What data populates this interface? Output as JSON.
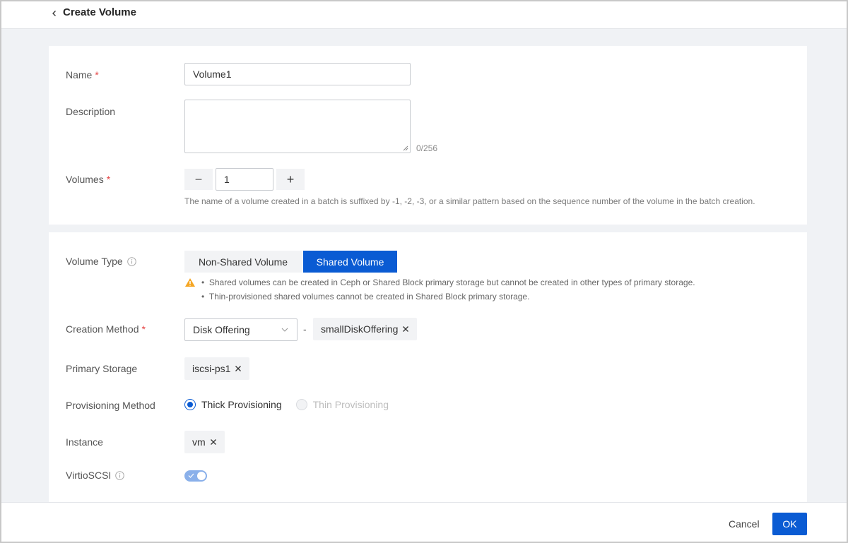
{
  "header": {
    "title": "Create Volume",
    "back_icon": "chevron-left-icon"
  },
  "basic": {
    "name": {
      "label": "Name",
      "required_mark": "*",
      "value": "Volume1"
    },
    "description": {
      "label": "Description",
      "value": "",
      "counter": "0/256"
    },
    "volumes": {
      "label": "Volumes",
      "required_mark": "*",
      "value": "1",
      "minus": "−",
      "plus": "+",
      "hint": "The name of a volume created in a batch is suffixed by -1, -2, -3, or a similar pattern based on the sequence number of the volume in the batch creation."
    }
  },
  "config": {
    "volume_type": {
      "label": "Volume Type",
      "info_icon": "info-icon",
      "options": [
        "Non-Shared Volume",
        "Shared Volume"
      ],
      "selected": "Shared Volume",
      "notes": [
        "Shared volumes can be created in Ceph or Shared Block primary storage but cannot be created in other types of primary storage.",
        "Thin-provisioned shared volumes cannot be created in Shared Block primary storage."
      ]
    },
    "creation_method": {
      "label": "Creation Method",
      "required_mark": "*",
      "select_value": "Disk Offering",
      "separator": "-",
      "tag": "smallDiskOffering"
    },
    "primary_storage": {
      "label": "Primary Storage",
      "tag": "iscsi-ps1"
    },
    "provisioning_method": {
      "label": "Provisioning Method",
      "options": [
        {
          "label": "Thick Provisioning",
          "checked": true,
          "disabled": false
        },
        {
          "label": "Thin Provisioning",
          "checked": false,
          "disabled": true
        }
      ]
    },
    "instance": {
      "label": "Instance",
      "tag": "vm"
    },
    "virtio_scsi": {
      "label": "VirtioSCSI",
      "enabled": true
    }
  },
  "footer": {
    "cancel_label": "Cancel",
    "ok_label": "OK"
  },
  "colors": {
    "accent": "#0a5bd3",
    "required": "#e54545",
    "warning": "#f5a623",
    "toggle_on": "#8ab0ea"
  }
}
